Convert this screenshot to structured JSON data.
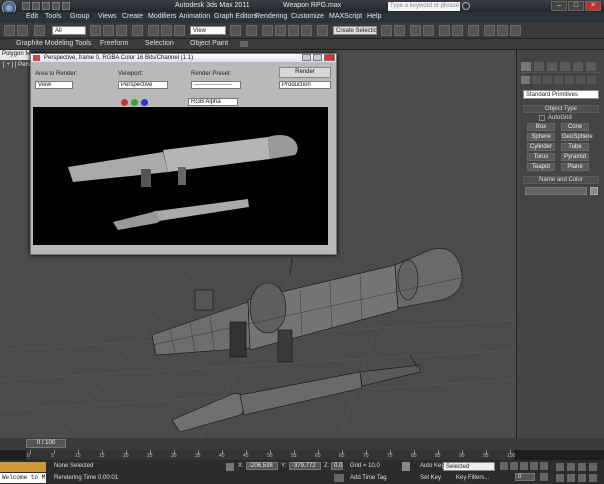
{
  "app": {
    "title": "Autodesk 3ds Max 2011",
    "file": "Weapon RPG.max",
    "search_placeholder": "Type a keyword or phrase"
  },
  "menu": [
    "Edit",
    "Tools",
    "Group",
    "Views",
    "Create",
    "Modifiers",
    "Animation",
    "Graph Editors",
    "Rendering",
    "Customize",
    "MAXScript",
    "Help"
  ],
  "toolbar": {
    "filter": "All",
    "ref_coord": "View",
    "named_selection": "Create Selection Set"
  },
  "ribbon": {
    "tabs": [
      "Graphite Modeling Tools",
      "Freeform",
      "Selection",
      "Object Paint"
    ],
    "subtab": "Polygon Modeling"
  },
  "viewport": {
    "label": "[ + ] [ Pers"
  },
  "render_frame": {
    "caption": "Perspective, frame 0, RGBA Color 16 Bits/Channel (1:1)",
    "area_label": "Area to Render:",
    "area_value": "View",
    "viewport_label": "Viewport:",
    "viewport_value": "Perspective",
    "preset_label": "Render Preset:",
    "preset_value": "-------------------",
    "render_button": "Render",
    "mode_value": "Production",
    "channel_value": "RGB Alpha"
  },
  "command_panel": {
    "category": "Standard Primitives",
    "object_type_title": "Object Type",
    "autogrid": "AutoGrid",
    "buttons": [
      "Box",
      "Cone",
      "Sphere",
      "GeoSphere",
      "Cylinder",
      "Tube",
      "Torus",
      "Pyramid",
      "Teapot",
      "Plane"
    ],
    "name_color_title": "Name and Color"
  },
  "timeline": {
    "frame": "0 / 100",
    "ticks": [
      "0",
      "5",
      "10",
      "15",
      "20",
      "25",
      "30",
      "35",
      "40",
      "45",
      "50",
      "55",
      "60",
      "65",
      "70",
      "75",
      "80",
      "85",
      "90",
      "95",
      "100"
    ]
  },
  "status": {
    "listener": "Welcome to M",
    "selection": "None Selected",
    "render_time": "Rendering Time  0:00:01",
    "x_label": "X:",
    "x": "-206,538",
    "y_label": "Y:",
    "y": "-379,772",
    "z_label": "Z:",
    "z": "0,0",
    "grid": "Grid = 10,0",
    "add_time_tag": "Add Time Tag",
    "auto_key": "Auto Key",
    "auto_key_value": "Selected",
    "set_key": "Set Key",
    "key_filters": "Key Filters...",
    "frame_field": "0"
  }
}
